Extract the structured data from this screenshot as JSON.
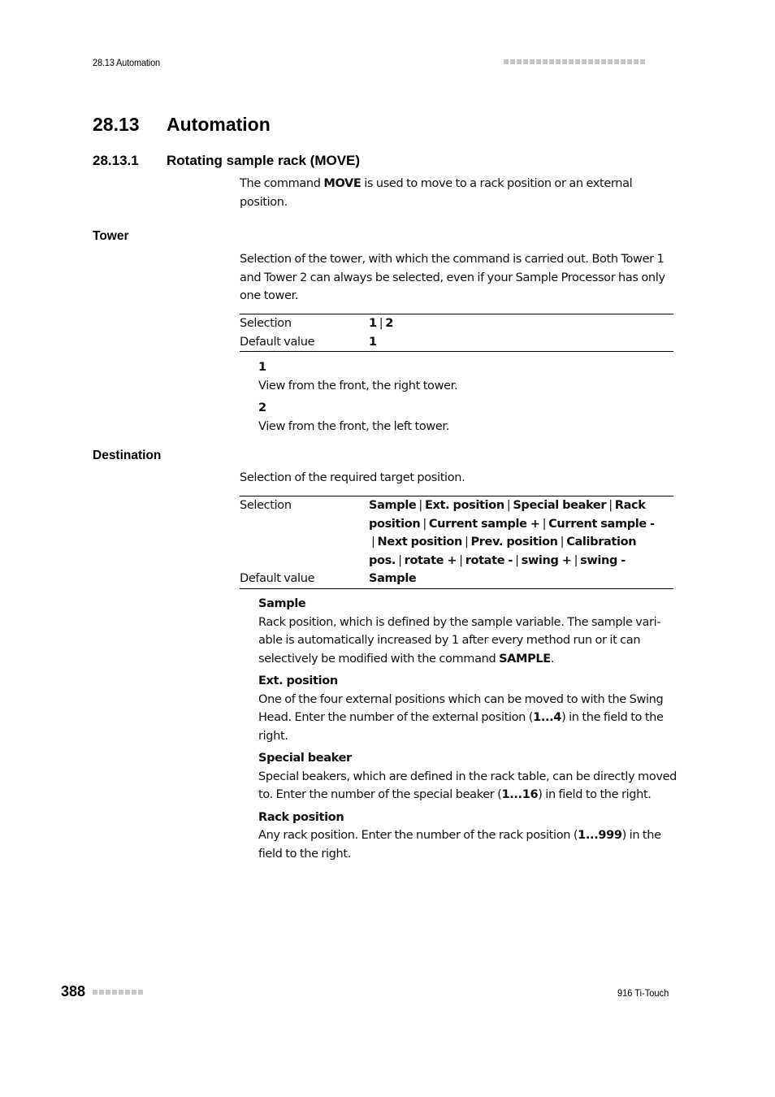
{
  "running_header": {
    "section": "28.13 Automation"
  },
  "heading1": {
    "number": "28.13",
    "title": "Automation"
  },
  "heading2": {
    "number": "28.13.1",
    "title": "Rotating sample rack (MOVE)"
  },
  "intro": {
    "pre": "The command ",
    "bold": "MOVE",
    "post": " is used to move to a rack position or an external position."
  },
  "tower": {
    "label": "Tower",
    "description": "Selection of the tower, with which the command is carried out. Both Tower 1 and Tower 2 can always be selected, even if your Sample Pro­cessor has only one tower.",
    "table": {
      "selection_key": "Selection",
      "selection_values": [
        "1",
        "2"
      ],
      "default_key": "Default value",
      "default_value": "1"
    },
    "options": [
      {
        "title": "1",
        "text": "View from the front, the right tower."
      },
      {
        "title": "2",
        "text": "View from the front, the left tower."
      }
    ]
  },
  "destination": {
    "label": "Destination",
    "description": "Selection of the required target position.",
    "table": {
      "selection_key": "Selection",
      "selection_values": [
        "Sample",
        "Ext. position",
        "Special beaker",
        "Rack position",
        "Current sample +",
        "Current sample -",
        "Next position",
        "Prev. position",
        "Calibration pos.",
        "rotate +",
        "rotate -",
        "swing +",
        "swing -"
      ],
      "default_key": "Default value",
      "default_value": "Sample"
    },
    "options": [
      {
        "title": "Sample",
        "text_pre": "Rack position, which is defined by the sample variable. The sample vari­able is automatically increased by 1 after every method run or it can selectively be modified with the command ",
        "text_bold": "SAMPLE",
        "text_post": "."
      },
      {
        "title": "Ext. position",
        "text_pre": "One of the four external positions which can be moved to with the Swing Head. Enter the number of the external position (",
        "text_bold": "1...4",
        "text_post": ") in the field to the right."
      },
      {
        "title": "Special beaker",
        "text_pre": "Special beakers, which are defined in the rack table, can be directly moved to. Enter the number of the special beaker (",
        "text_bold": "1...16",
        "text_post": ") in field to the right."
      },
      {
        "title": "Rack position",
        "text_pre": "Any rack position. Enter the number of the rack position (",
        "text_bold": "1...999",
        "text_post": ") in the field to the right."
      }
    ]
  },
  "footer": {
    "page_number": "388",
    "product": "916 Ti-Touch"
  }
}
